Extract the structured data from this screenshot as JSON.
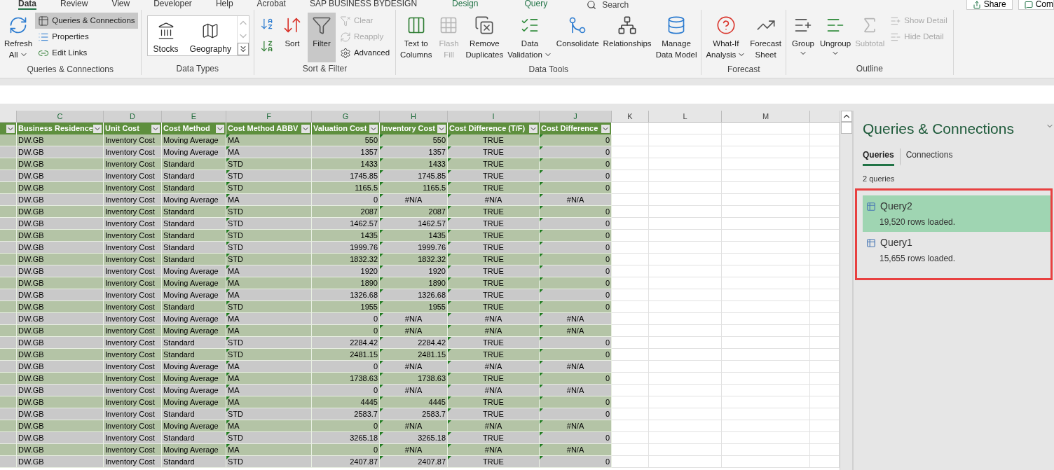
{
  "ribbon_tabs": [
    {
      "label": "Data",
      "selected": true,
      "contextual": false
    },
    {
      "label": "Review",
      "selected": false,
      "contextual": false
    },
    {
      "label": "View",
      "selected": false,
      "contextual": false
    },
    {
      "label": "Developer",
      "selected": false,
      "contextual": false
    },
    {
      "label": "Help",
      "selected": false,
      "contextual": false
    },
    {
      "label": "Acrobat",
      "selected": false,
      "contextual": false
    },
    {
      "label": "SAP BUSINESS BYDESIGN",
      "selected": false,
      "contextual": false
    },
    {
      "label": "Design",
      "selected": false,
      "contextual": true
    },
    {
      "label": "Query",
      "selected": false,
      "contextual": true
    }
  ],
  "search": {
    "placeholder": "Search"
  },
  "share_button": "Share",
  "comments_button": "Com",
  "ribbon_groups": [
    {
      "label": "Queries & Connections",
      "items": [
        {
          "kind": "large",
          "lines": [
            "Refresh",
            "All"
          ],
          "dropdown": true,
          "on": false,
          "disabled": false
        },
        {
          "kind": "small",
          "lines": [
            "Queries & Connections"
          ],
          "dropdown": false,
          "on": true,
          "disabled": false
        },
        {
          "kind": "small",
          "lines": [
            "Properties"
          ],
          "dropdown": false,
          "on": false,
          "disabled": false
        },
        {
          "kind": "small",
          "lines": [
            "Edit Links"
          ],
          "dropdown": false,
          "on": false,
          "disabled": false
        }
      ]
    },
    {
      "label": "Data Types",
      "items": [
        {
          "kind": "gallery",
          "lines": [
            "Stocks"
          ],
          "on": false,
          "disabled": false
        },
        {
          "kind": "gallery",
          "lines": [
            "Geography"
          ],
          "on": false,
          "disabled": false
        }
      ]
    },
    {
      "label": "Sort & Filter",
      "items": [
        {
          "kind": "icon",
          "on": false,
          "disabled": false
        },
        {
          "kind": "icon",
          "on": false,
          "disabled": false
        },
        {
          "kind": "large",
          "lines": [
            "Sort"
          ],
          "dropdown": false,
          "on": false,
          "disabled": false
        },
        {
          "kind": "large",
          "lines": [
            "Filter"
          ],
          "dropdown": false,
          "on": true,
          "disabled": false
        },
        {
          "kind": "small",
          "lines": [
            "Clear"
          ],
          "dropdown": false,
          "on": false,
          "disabled": true
        },
        {
          "kind": "small",
          "lines": [
            "Reapply"
          ],
          "dropdown": false,
          "on": false,
          "disabled": true
        },
        {
          "kind": "small",
          "lines": [
            "Advanced"
          ],
          "dropdown": false,
          "on": false,
          "disabled": false
        }
      ]
    },
    {
      "label": "Data Tools",
      "items": [
        {
          "kind": "large",
          "lines": [
            "Text to",
            "Columns"
          ],
          "dropdown": false,
          "on": false,
          "disabled": false
        },
        {
          "kind": "large",
          "lines": [
            "Flash",
            "Fill"
          ],
          "dropdown": false,
          "on": false,
          "disabled": true
        },
        {
          "kind": "large",
          "lines": [
            "Remove",
            "Duplicates"
          ],
          "dropdown": false,
          "on": false,
          "disabled": false
        },
        {
          "kind": "large",
          "lines": [
            "Data",
            "Validation"
          ],
          "dropdown": true,
          "on": false,
          "disabled": false
        },
        {
          "kind": "large",
          "lines": [
            "Consolidate"
          ],
          "dropdown": false,
          "on": false,
          "disabled": false
        },
        {
          "kind": "large",
          "lines": [
            "Relationships"
          ],
          "dropdown": false,
          "on": false,
          "disabled": false
        },
        {
          "kind": "large",
          "lines": [
            "Manage",
            "Data Model"
          ],
          "dropdown": false,
          "on": false,
          "disabled": false
        }
      ]
    },
    {
      "label": "Forecast",
      "items": [
        {
          "kind": "large",
          "lines": [
            "What-If",
            "Analysis"
          ],
          "dropdown": true,
          "on": false,
          "disabled": false
        },
        {
          "kind": "large",
          "lines": [
            "Forecast",
            "Sheet"
          ],
          "dropdown": false,
          "on": false,
          "disabled": false
        }
      ]
    },
    {
      "label": "Outline",
      "items": [
        {
          "kind": "large",
          "lines": [
            "Group"
          ],
          "dropdown": true,
          "on": false,
          "disabled": false
        },
        {
          "kind": "large",
          "lines": [
            "Ungroup"
          ],
          "dropdown": true,
          "on": false,
          "disabled": false
        },
        {
          "kind": "large",
          "lines": [
            "Subtotal"
          ],
          "dropdown": false,
          "on": false,
          "disabled": true
        },
        {
          "kind": "small",
          "lines": [
            "Show Detail"
          ],
          "dropdown": false,
          "on": false,
          "disabled": true
        },
        {
          "kind": "small",
          "lines": [
            "Hide Detail"
          ],
          "dropdown": false,
          "on": false,
          "disabled": true
        }
      ]
    }
  ],
  "column_letters": [
    {
      "label": "C",
      "selected": true
    },
    {
      "label": "D",
      "selected": true
    },
    {
      "label": "E",
      "selected": true
    },
    {
      "label": "F",
      "selected": true
    },
    {
      "label": "G",
      "selected": true
    },
    {
      "label": "H",
      "selected": true
    },
    {
      "label": "I",
      "selected": true
    },
    {
      "label": "J",
      "selected": true
    },
    {
      "label": "K",
      "selected": false
    },
    {
      "label": "L",
      "selected": false
    },
    {
      "label": "M",
      "selected": false
    }
  ],
  "table": {
    "columns": [
      {
        "label": "Business Residence",
        "flagged": false
      },
      {
        "label": "Unit Cost",
        "flagged": false
      },
      {
        "label": "Cost Method",
        "flagged": false
      },
      {
        "label": "Cost Method ABBV",
        "flagged": true
      },
      {
        "label": "Valuation Cost",
        "flagged": false
      },
      {
        "label": "Inventory Cost",
        "flagged": true
      },
      {
        "label": "Cost Difference (T/F)",
        "flagged": true
      },
      {
        "label": "Cost Difference",
        "flagged": true
      }
    ],
    "rows": [
      [
        "DW.GB",
        "Inventory Cost",
        "Moving Average",
        "MA",
        "550",
        "550",
        "TRUE",
        "0"
      ],
      [
        "DW.GB",
        "Inventory Cost",
        "Moving Average",
        "MA",
        "1357",
        "1357",
        "TRUE",
        "0"
      ],
      [
        "DW.GB",
        "Inventory Cost",
        "Standard",
        "STD",
        "1433",
        "1433",
        "TRUE",
        "0"
      ],
      [
        "DW.GB",
        "Inventory Cost",
        "Standard",
        "STD",
        "1745.85",
        "1745.85",
        "TRUE",
        "0"
      ],
      [
        "DW.GB",
        "Inventory Cost",
        "Standard",
        "STD",
        "1165.5",
        "1165.5",
        "TRUE",
        "0"
      ],
      [
        "DW.GB",
        "Inventory Cost",
        "Moving Average",
        "MA",
        "0",
        "#N/A",
        "#N/A",
        "#N/A"
      ],
      [
        "DW.GB",
        "Inventory Cost",
        "Standard",
        "STD",
        "2087",
        "2087",
        "TRUE",
        "0"
      ],
      [
        "DW.GB",
        "Inventory Cost",
        "Standard",
        "STD",
        "1462.57",
        "1462.57",
        "TRUE",
        "0"
      ],
      [
        "DW.GB",
        "Inventory Cost",
        "Standard",
        "STD",
        "1435",
        "1435",
        "TRUE",
        "0"
      ],
      [
        "DW.GB",
        "Inventory Cost",
        "Standard",
        "STD",
        "1999.76",
        "1999.76",
        "TRUE",
        "0"
      ],
      [
        "DW.GB",
        "Inventory Cost",
        "Standard",
        "STD",
        "1832.32",
        "1832.32",
        "TRUE",
        "0"
      ],
      [
        "DW.GB",
        "Inventory Cost",
        "Moving Average",
        "MA",
        "1920",
        "1920",
        "TRUE",
        "0"
      ],
      [
        "DW.GB",
        "Inventory Cost",
        "Moving Average",
        "MA",
        "1890",
        "1890",
        "TRUE",
        "0"
      ],
      [
        "DW.GB",
        "Inventory Cost",
        "Moving Average",
        "MA",
        "1326.68",
        "1326.68",
        "TRUE",
        "0"
      ],
      [
        "DW.GB",
        "Inventory Cost",
        "Standard",
        "STD",
        "1955",
        "1955",
        "TRUE",
        "0"
      ],
      [
        "DW.GB",
        "Inventory Cost",
        "Moving Average",
        "MA",
        "0",
        "#N/A",
        "#N/A",
        "#N/A"
      ],
      [
        "DW.GB",
        "Inventory Cost",
        "Moving Average",
        "MA",
        "0",
        "#N/A",
        "#N/A",
        "#N/A"
      ],
      [
        "DW.GB",
        "Inventory Cost",
        "Standard",
        "STD",
        "2284.42",
        "2284.42",
        "TRUE",
        "0"
      ],
      [
        "DW.GB",
        "Inventory Cost",
        "Standard",
        "STD",
        "2481.15",
        "2481.15",
        "TRUE",
        "0"
      ],
      [
        "DW.GB",
        "Inventory Cost",
        "Moving Average",
        "MA",
        "0",
        "#N/A",
        "#N/A",
        "#N/A"
      ],
      [
        "DW.GB",
        "Inventory Cost",
        "Moving Average",
        "MA",
        "1738.63",
        "1738.63",
        "TRUE",
        "0"
      ],
      [
        "DW.GB",
        "Inventory Cost",
        "Moving Average",
        "MA",
        "0",
        "#N/A",
        "#N/A",
        "#N/A"
      ],
      [
        "DW.GB",
        "Inventory Cost",
        "Moving Average",
        "MA",
        "4445",
        "4445",
        "TRUE",
        "0"
      ],
      [
        "DW.GB",
        "Inventory Cost",
        "Standard",
        "STD",
        "2583.7",
        "2583.7",
        "TRUE",
        "0"
      ],
      [
        "DW.GB",
        "Inventory Cost",
        "Moving Average",
        "MA",
        "0",
        "#N/A",
        "#N/A",
        "#N/A"
      ],
      [
        "DW.GB",
        "Inventory Cost",
        "Standard",
        "STD",
        "3265.18",
        "3265.18",
        "TRUE",
        "0"
      ],
      [
        "DW.GB",
        "Inventory Cost",
        "Moving Average",
        "MA",
        "0",
        "#N/A",
        "#N/A",
        "#N/A"
      ],
      [
        "DW.GB",
        "Inventory Cost",
        "Standard",
        "STD",
        "2407.87",
        "2407.87",
        "TRUE",
        "0"
      ]
    ]
  },
  "panel": {
    "title": "Queries & Connections",
    "tabs": [
      {
        "label": "Queries",
        "selected": true
      },
      {
        "label": "Connections",
        "selected": false
      }
    ],
    "count": "2 queries",
    "queries": [
      {
        "name": "Query2",
        "detail": "19,520 rows loaded.",
        "selected": true
      },
      {
        "name": "Query1",
        "detail": "15,655 rows loaded.",
        "selected": false
      }
    ]
  }
}
